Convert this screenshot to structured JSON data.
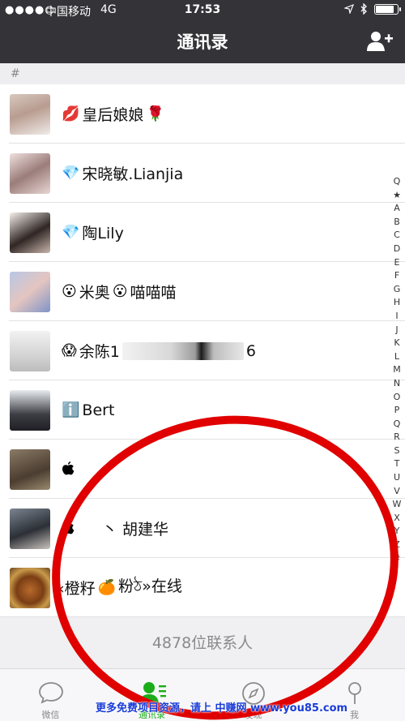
{
  "status_bar": {
    "signal": "●●●●○",
    "carrier": "中国移动",
    "network": "4G",
    "time": "17:53"
  },
  "nav": {
    "title": "通讯录",
    "add_icon": "add-friend-icon"
  },
  "section": {
    "header": "#"
  },
  "contacts": [
    {
      "avatar": "photo",
      "emoji_before": "💋",
      "name": "皇后娘娘",
      "emoji_after": "🌹"
    },
    {
      "avatar": "photo",
      "emoji_before": "💎",
      "name": "宋晓敏.Lianjia",
      "emoji_after": ""
    },
    {
      "avatar": "photo",
      "emoji_before": "💎",
      "name": "陶Lily",
      "emoji_after": ""
    },
    {
      "avatar": "photo",
      "emoji_before": "😮",
      "name": "米奥",
      "emoji_after": "😮",
      "name_after": "喵喵喵"
    },
    {
      "avatar": "photo",
      "emoji_before": "😱",
      "name": "余陈1",
      "redacted": true,
      "name_after": "6"
    },
    {
      "avatar": "photo",
      "emoji_before": "ℹ️",
      "name": "Bert",
      "emoji_after": ""
    },
    {
      "avatar": "photo",
      "emoji_before": "",
      "name": "",
      "emoji_after": ""
    },
    {
      "avatar": "photo",
      "emoji_before": "",
      "name": "丶 胡建华",
      "emoji_after": ""
    },
    {
      "avatar": "photo",
      "emoji_before": "",
      "name": "«橙籽",
      "emoji_after": "🍊",
      "name_after": "粉ঠ»在线"
    }
  ],
  "contact_count": "4878位联系人",
  "index_letters": [
    "Q",
    "★",
    "A",
    "B",
    "C",
    "D",
    "E",
    "F",
    "G",
    "H",
    "I",
    "J",
    "K",
    "L",
    "M",
    "N",
    "O",
    "P",
    "Q",
    "R",
    "S",
    "T",
    "U",
    "V",
    "W",
    "X",
    "Y",
    "Z",
    "#"
  ],
  "tabs": [
    {
      "label": "微信",
      "icon": "chat-bubble-icon",
      "active": false
    },
    {
      "label": "通讯录",
      "icon": "contacts-icon",
      "active": true
    },
    {
      "label": "发现",
      "icon": "compass-icon",
      "active": false
    },
    {
      "label": "我",
      "icon": "person-icon",
      "active": false
    }
  ],
  "watermark": "更多免费项目资源，请上 中赚网 www.you85.com",
  "colors": {
    "nav_bg": "#333338",
    "active_tab": "#1aad19",
    "annotation_circle": "#e00000"
  }
}
